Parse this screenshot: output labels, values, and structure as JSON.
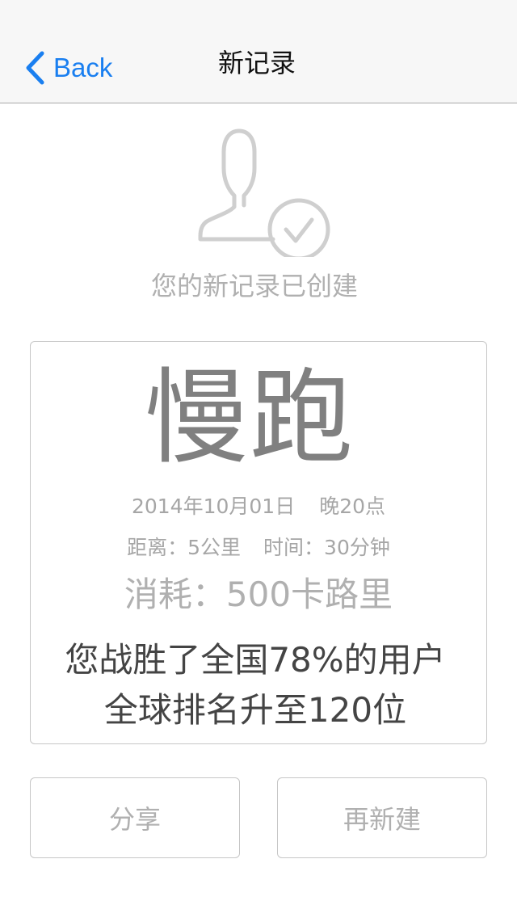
{
  "nav": {
    "back_label": "Back",
    "title": "新记录"
  },
  "header": {
    "icon": "user-check-icon",
    "status_text": "您的新记录已创建"
  },
  "record": {
    "activity": "慢跑",
    "date": "2014年10月01日",
    "time_of_day": "晚20点",
    "distance": "距离：5公里",
    "duration": "时间：30分钟",
    "calories": "消耗：500卡路里",
    "percentile_text": "您战胜了全国78%的用户",
    "ranking_text": "全球排名升至120位"
  },
  "actions": {
    "share_label": "分享",
    "new_label": "再新建"
  },
  "colors": {
    "accent": "#1a7ff0",
    "muted_text": "#b0b0b0",
    "title_text": "#808080",
    "strong_text": "#444444",
    "border": "#c6c6c6",
    "nav_bg": "#f7f7f7"
  }
}
